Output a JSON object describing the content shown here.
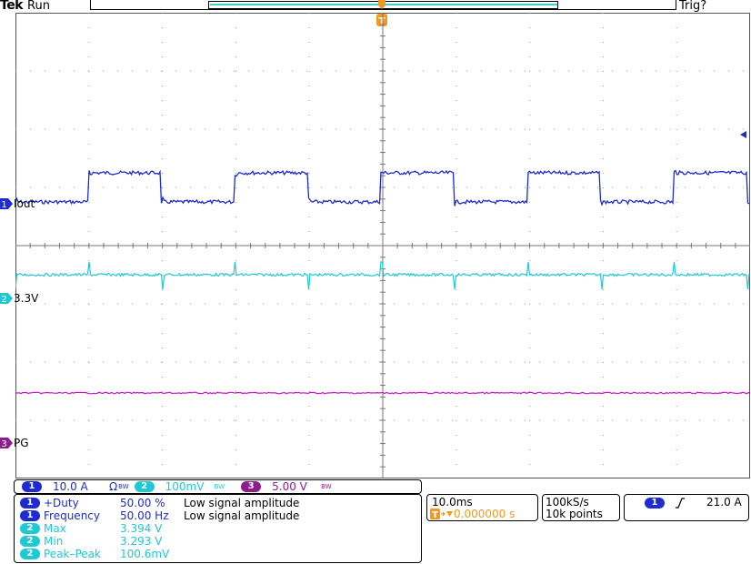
{
  "header": {
    "brand": "Tek",
    "status": "Run",
    "trigger_status": "Trig?"
  },
  "colors": {
    "ch1": "#1e2bd0",
    "ch2": "#1ec9d4",
    "ch3": "#c814c8",
    "trigger": "#f39a1e",
    "grid": "#9a9a9a"
  },
  "channels": [
    {
      "label": "Iout",
      "number": "1"
    },
    {
      "label": "3.3V",
      "number": "2"
    },
    {
      "label": "PG",
      "number": "3"
    }
  ],
  "scale": {
    "ch1_num": "1",
    "ch1_value": "10.0 A",
    "ch1_unit_icon": "Ω",
    "ch2_num": "2",
    "ch2_value": "100mV",
    "ch3_num": "3",
    "ch3_value": "5.00 V",
    "bw_mark": "BW"
  },
  "measurements": [
    {
      "ch": "1",
      "name": "+Duty",
      "value": "50.00 %",
      "note": "Low signal amplitude"
    },
    {
      "ch": "1",
      "name": "Frequency",
      "value": "50.00 Hz",
      "note": "Low signal amplitude"
    },
    {
      "ch": "2",
      "name": "Max",
      "value": "3.394 V",
      "note": ""
    },
    {
      "ch": "2",
      "name": "Min",
      "value": "3.293 V",
      "note": ""
    },
    {
      "ch": "2",
      "name": "Peak–Peak",
      "value": "100.6mV",
      "note": ""
    }
  ],
  "timebase": {
    "scale": "10.0ms",
    "trigger_marker": "T",
    "position": "0.000000 s"
  },
  "acquisition": {
    "sample_rate": "100kS/s",
    "record_length": "10k points"
  },
  "trigger": {
    "source": "1",
    "level": "21.0 A"
  }
}
